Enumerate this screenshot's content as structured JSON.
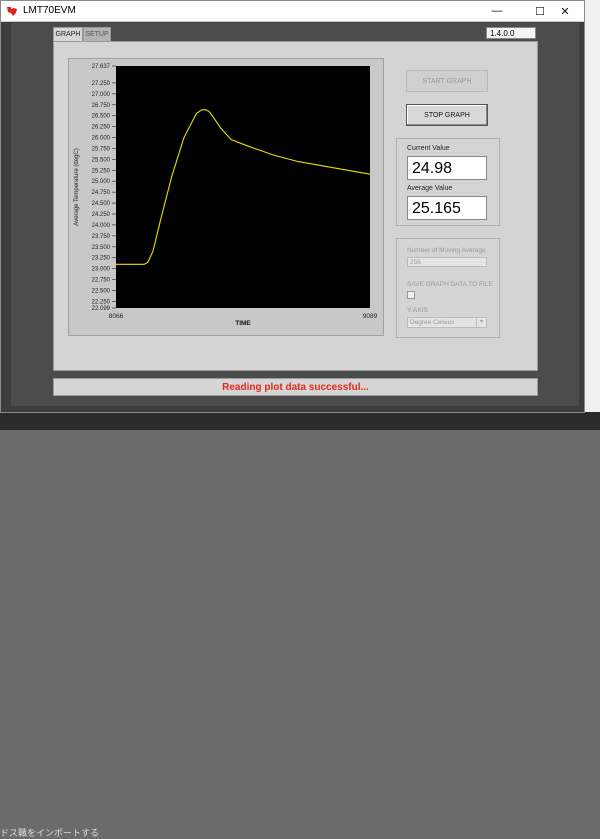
{
  "window": {
    "title": "LMT70EVM",
    "minimize": "—",
    "maximize": "☐",
    "close": "✕"
  },
  "version": {
    "label": "",
    "value": "1.4.0.0"
  },
  "tabs": [
    {
      "label": "GRAPH",
      "active": true
    },
    {
      "label": "SETUP",
      "active": false
    }
  ],
  "buttons": {
    "start_graph": "START GRAPH",
    "stop_graph": "STOP GRAPH"
  },
  "values": {
    "current_label": "Current Value",
    "current": "24.98",
    "average_label": "Average Value",
    "average": "25.165"
  },
  "settings": {
    "moving_avg_label": "Number of Moving Average",
    "moving_avg": "256",
    "save_label": "SAVE GRAPH DATA TO FILE",
    "yaxis_label": "Y-AXIS",
    "yaxis_value": "Degree Celsius"
  },
  "status": {
    "message": "Reading plot data successful..."
  },
  "desktop": {
    "taskbar_text": "ドス職をインポートする"
  },
  "colors": {
    "plot_bg": "#000000",
    "plot_line": "#e8e000",
    "status_text": "#e22a1a"
  },
  "chart_data": {
    "type": "line",
    "title": "",
    "xlabel": "TIME",
    "ylabel": "Average Temperature (degC)",
    "xlim": [
      8066,
      9089
    ],
    "ylim": [
      22.099,
      27.637
    ],
    "x_ticks": [
      "8066",
      "9089"
    ],
    "y_ticks": [
      "27.637",
      "27.250",
      "27.000",
      "26.750",
      "26.500",
      "26.250",
      "26.000",
      "25.750",
      "25.500",
      "25.250",
      "25.000",
      "24.750",
      "24.500",
      "24.250",
      "24.000",
      "23.750",
      "23.500",
      "23.250",
      "23.000",
      "22.750",
      "22.500",
      "22.250",
      "22.099"
    ],
    "series": [
      {
        "x": [
          8066,
          8180,
          8195,
          8215,
          8245,
          8290,
          8340,
          8390,
          8410,
          8425,
          8440,
          8460,
          8490,
          8530,
          8600,
          8700,
          8800,
          8900,
          9000,
          9089
        ],
        "y": [
          23.1,
          23.1,
          23.15,
          23.4,
          24.1,
          25.1,
          26.0,
          26.55,
          26.63,
          26.64,
          26.6,
          26.45,
          26.2,
          25.95,
          25.8,
          25.6,
          25.45,
          25.35,
          25.25,
          25.16
        ]
      }
    ]
  }
}
